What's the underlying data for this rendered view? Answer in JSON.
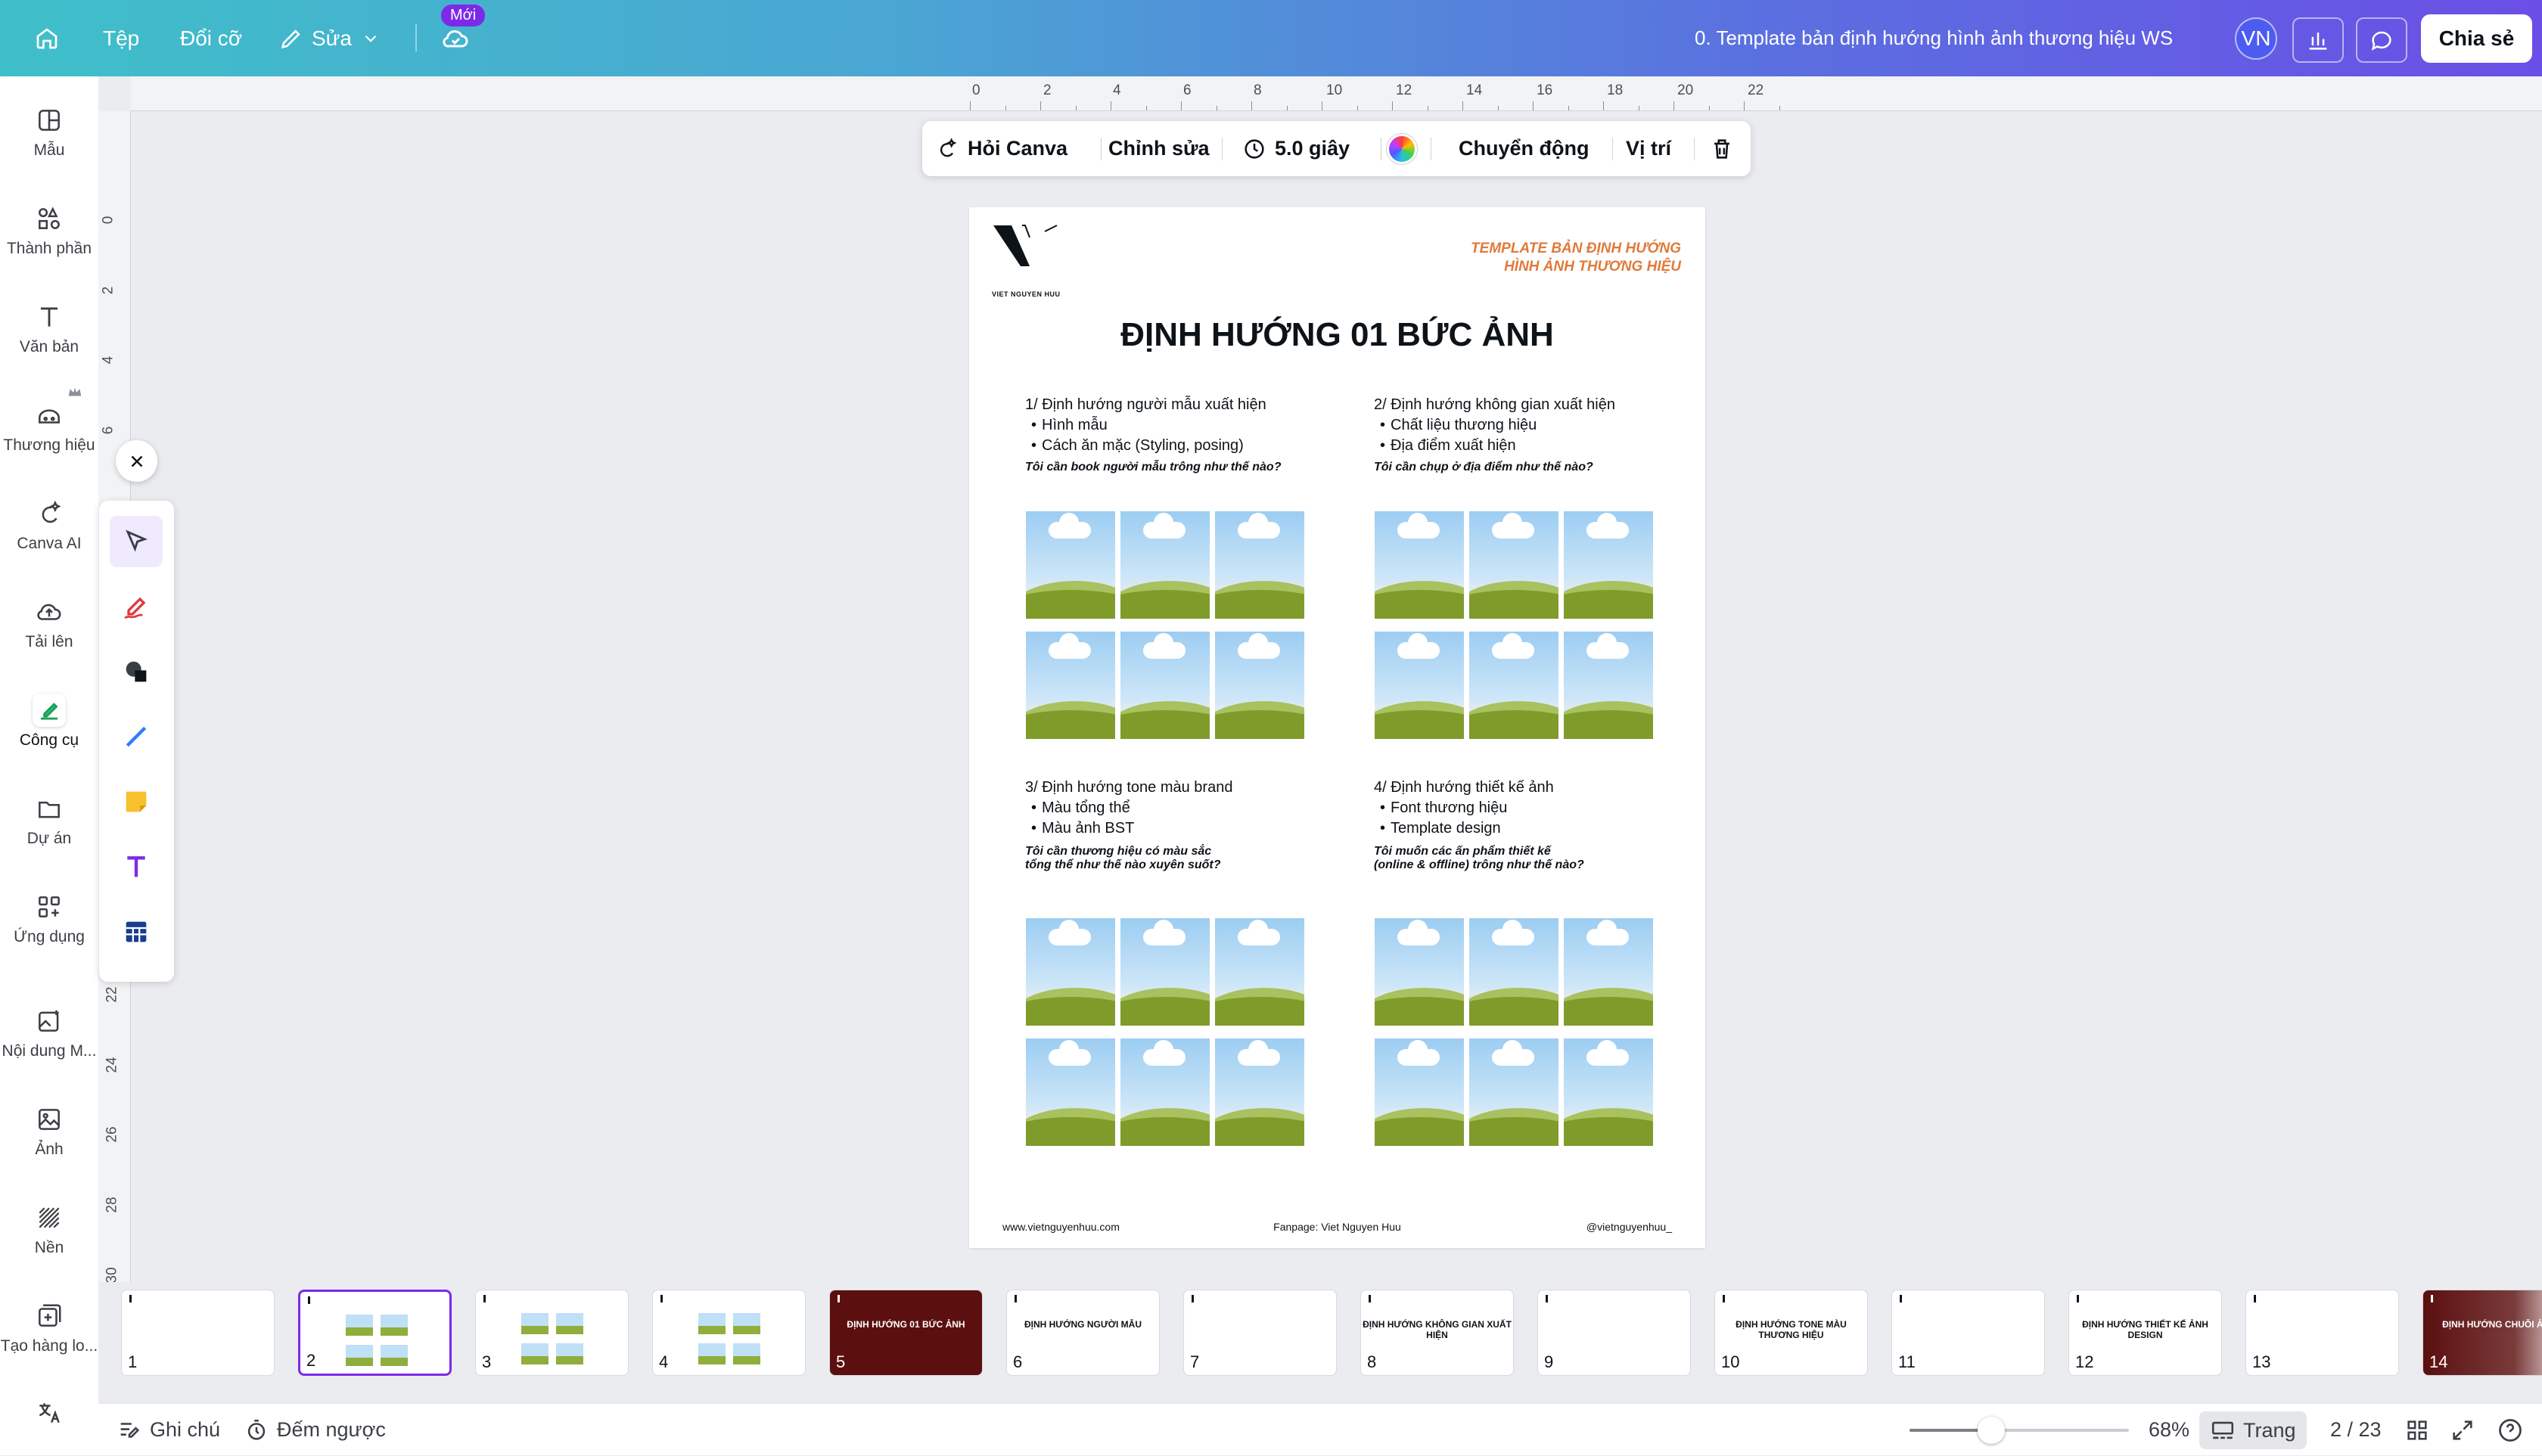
{
  "topbar": {
    "file_label": "Tệp",
    "resize_label": "Đổi cỡ",
    "edit_label": "Sửa",
    "new_badge": "Mới",
    "doc_title": "0. Template bản định hướng hình ảnh thương hiệu WS",
    "avatar_initials": "VN",
    "share_label": "Chia sẻ"
  },
  "sidebar": {
    "items": [
      {
        "label": "Mẫu",
        "icon": "template-icon"
      },
      {
        "label": "Thành phần",
        "icon": "elements-icon"
      },
      {
        "label": "Văn bản",
        "icon": "text-icon"
      },
      {
        "label": "Thương hiệu",
        "icon": "brand-icon"
      },
      {
        "label": "Canva AI",
        "icon": "magic-icon"
      },
      {
        "label": "Tải lên",
        "icon": "upload-cloud-icon"
      },
      {
        "label": "Công cụ",
        "icon": "tools-icon"
      },
      {
        "label": "Dự án",
        "icon": "folder-icon"
      },
      {
        "label": "Ứng dụng",
        "icon": "apps-icon"
      },
      {
        "label": "Nội dung M...",
        "icon": "magic-media-icon"
      },
      {
        "label": "Ảnh",
        "icon": "photo-icon"
      },
      {
        "label": "Nền",
        "icon": "background-icon"
      },
      {
        "label": "Tạo hàng lo...",
        "icon": "bulk-create-icon"
      }
    ]
  },
  "ruler": {
    "h_ticks": [
      "0",
      "2",
      "4",
      "6",
      "8",
      "10",
      "12",
      "14",
      "16",
      "18",
      "20",
      "22"
    ],
    "v_ticks": [
      "0",
      "2",
      "4",
      "6",
      "22",
      "24",
      "26",
      "28",
      "30"
    ]
  },
  "context_toolbar": {
    "ask_canva": "Hỏi Canva",
    "edit": "Chỉnh sửa",
    "duration": "5.0 giây",
    "animate": "Chuyển động",
    "position": "Vị trí"
  },
  "page": {
    "brand_name": "VIET NGUYEN HUU",
    "top_right_line1": "TEMPLATE BẢN ĐỊNH HƯỚNG",
    "top_right_line2": "HÌNH ẢNH THƯƠNG HIỆU",
    "heading": "ĐỊNH HƯỚNG 01 BỨC ẢNH",
    "sections": [
      {
        "title": "1/ Định hướng người mẫu xuất hiện",
        "bullets": [
          "Hình mẫu",
          "Cách ăn mặc (Styling, posing)"
        ],
        "question": "Tôi cần book người mẫu trông như thế nào?",
        "question2": ""
      },
      {
        "title": "2/ Định hướng không gian xuất hiện",
        "bullets": [
          "Chất liệu thương hiệu",
          "Địa điểm xuất hiện"
        ],
        "question": "Tôi cần chụp ở địa điểm như thế nào?",
        "question2": ""
      },
      {
        "title": "3/ Định hướng tone màu brand",
        "bullets": [
          "Màu tổng thể",
          "Màu ảnh BST"
        ],
        "question": "Tôi cần thương hiệu có màu sắc",
        "question2": "tổng thể như thế nào xuyên suốt?"
      },
      {
        "title": "4/ Định hướng thiết kế ảnh",
        "bullets": [
          "Font thương hiệu",
          "Template design"
        ],
        "question": "Tôi muốn các ấn phẩm thiết kế",
        "question2": "(online & offline) trông như thế nào?"
      }
    ],
    "footer_left": "www.vietnguyenhuu.com",
    "footer_center": "Fanpage: Viet Nguyen Huu",
    "footer_right": "@vietnguyenhuu_"
  },
  "thumbnails": [
    {
      "num": "1",
      "title": "",
      "dark": false
    },
    {
      "num": "2",
      "title": "",
      "dark": false,
      "selected": true
    },
    {
      "num": "3",
      "title": "",
      "dark": false
    },
    {
      "num": "4",
      "title": "",
      "dark": false
    },
    {
      "num": "5",
      "title": "ĐỊNH HƯỚNG 01 BỨC ẢNH",
      "dark": true
    },
    {
      "num": "6",
      "title": "ĐỊNH HƯỚNG NGƯỜI MẪU",
      "dark": false
    },
    {
      "num": "7",
      "title": "",
      "dark": false
    },
    {
      "num": "8",
      "title": "ĐỊNH HƯỚNG KHÔNG GIAN XUẤT HIỆN",
      "dark": false
    },
    {
      "num": "9",
      "title": "",
      "dark": false
    },
    {
      "num": "10",
      "title": "ĐỊNH HƯỚNG TONE MÀU THƯƠNG HIỆU",
      "dark": false
    },
    {
      "num": "11",
      "title": "",
      "dark": false
    },
    {
      "num": "12",
      "title": "ĐỊNH HƯỚNG THIẾT KẾ ẢNH DESIGN",
      "dark": false
    },
    {
      "num": "13",
      "title": "",
      "dark": false
    },
    {
      "num": "14",
      "title": "ĐỊNH HƯỚNG CHUỖI ẢNH",
      "dark": true
    }
  ],
  "bottombar": {
    "notes": "Ghi chú",
    "timer": "Đếm ngược",
    "zoom_value": 0.68,
    "zoom_label": "68%",
    "pages_label": "Trang",
    "page_counter": "2 / 23"
  },
  "colors": {
    "accent_purple": "#7d2ae8",
    "heading_orange": "#e07a3a",
    "thumb_dark": "#5b0f0f"
  }
}
